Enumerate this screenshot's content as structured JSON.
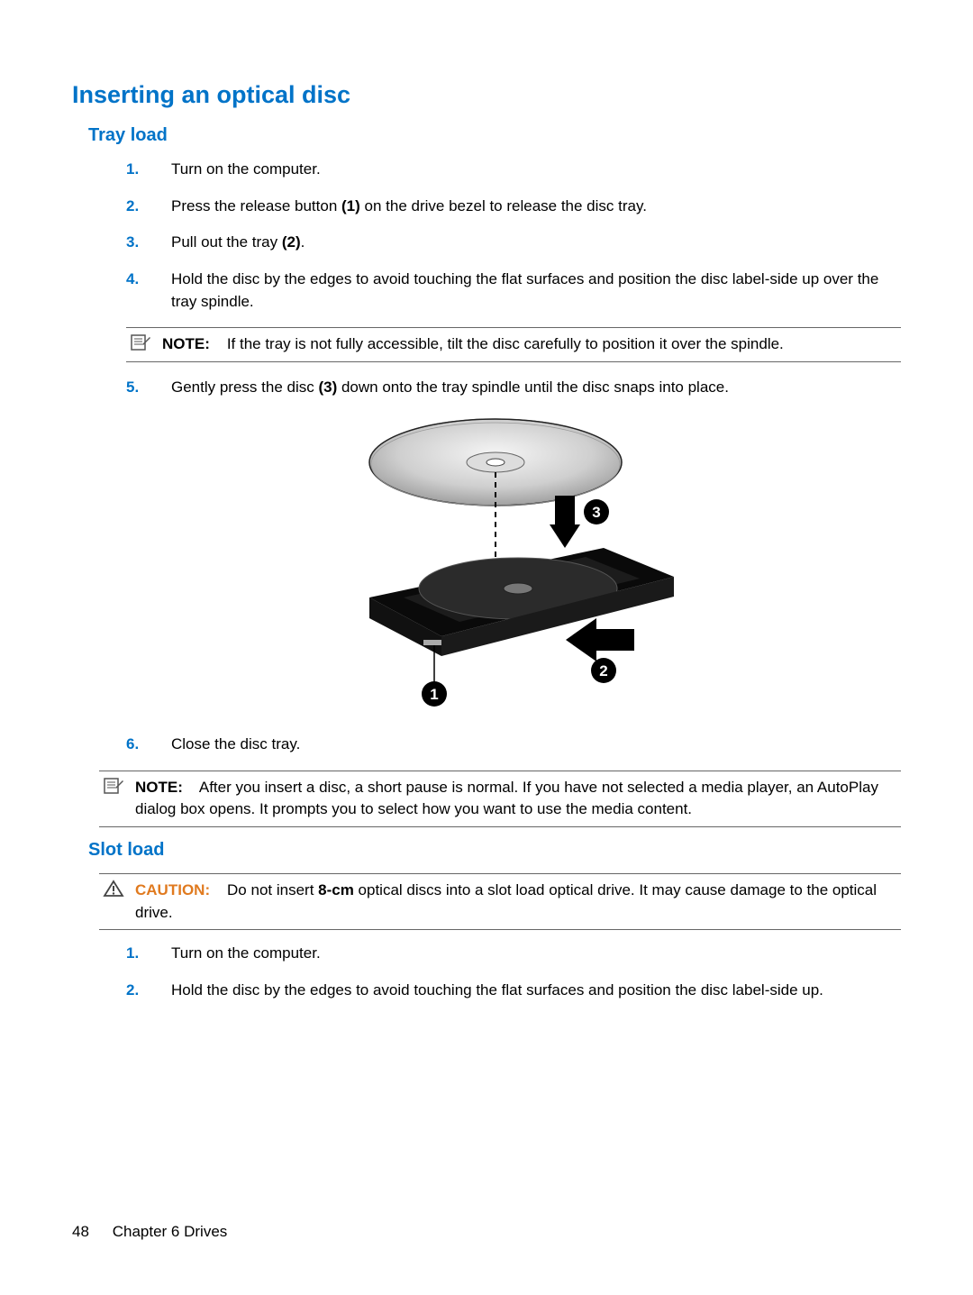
{
  "heading_main": "Inserting an optical disc",
  "tray": {
    "heading": "Tray load",
    "steps": {
      "s1": {
        "num": "1.",
        "text": "Turn on the computer."
      },
      "s2": {
        "num": "2.",
        "pre": "Press the release button ",
        "bold": "(1)",
        "post": " on the drive bezel to release the disc tray."
      },
      "s3": {
        "num": "3.",
        "pre": "Pull out the tray ",
        "bold": "(2)",
        "post": "."
      },
      "s4": {
        "num": "4.",
        "text": "Hold the disc by the edges to avoid touching the flat surfaces and position the disc label-side up over the tray spindle."
      },
      "note1": {
        "label": "NOTE:",
        "text": "If the tray is not fully accessible, tilt the disc carefully to position it over the spindle."
      },
      "s5": {
        "num": "5.",
        "pre": "Gently press the disc ",
        "bold": "(3)",
        "post": " down onto the tray spindle until the disc snaps into place."
      },
      "s6": {
        "num": "6.",
        "text": "Close the disc tray."
      },
      "note2": {
        "label": "NOTE:",
        "text": "After you insert a disc, a short pause is normal. If you have not selected a media player, an AutoPlay dialog box opens. It prompts you to select how you want to use the media content."
      }
    }
  },
  "slot": {
    "heading": "Slot load",
    "caution": {
      "label": "CAUTION:",
      "pre": "Do not insert ",
      "bold": "8-cm",
      "post": " optical discs into a slot load optical drive. It may cause damage to the optical drive."
    },
    "steps": {
      "s1": {
        "num": "1.",
        "text": "Turn on the computer."
      },
      "s2": {
        "num": "2.",
        "text": "Hold the disc by the edges to avoid touching the flat surfaces and position the disc label-side up."
      }
    }
  },
  "figure": {
    "callout1": "1",
    "callout2": "2",
    "callout3": "3"
  },
  "footer": {
    "page": "48",
    "chapter": "Chapter 6   Drives"
  }
}
